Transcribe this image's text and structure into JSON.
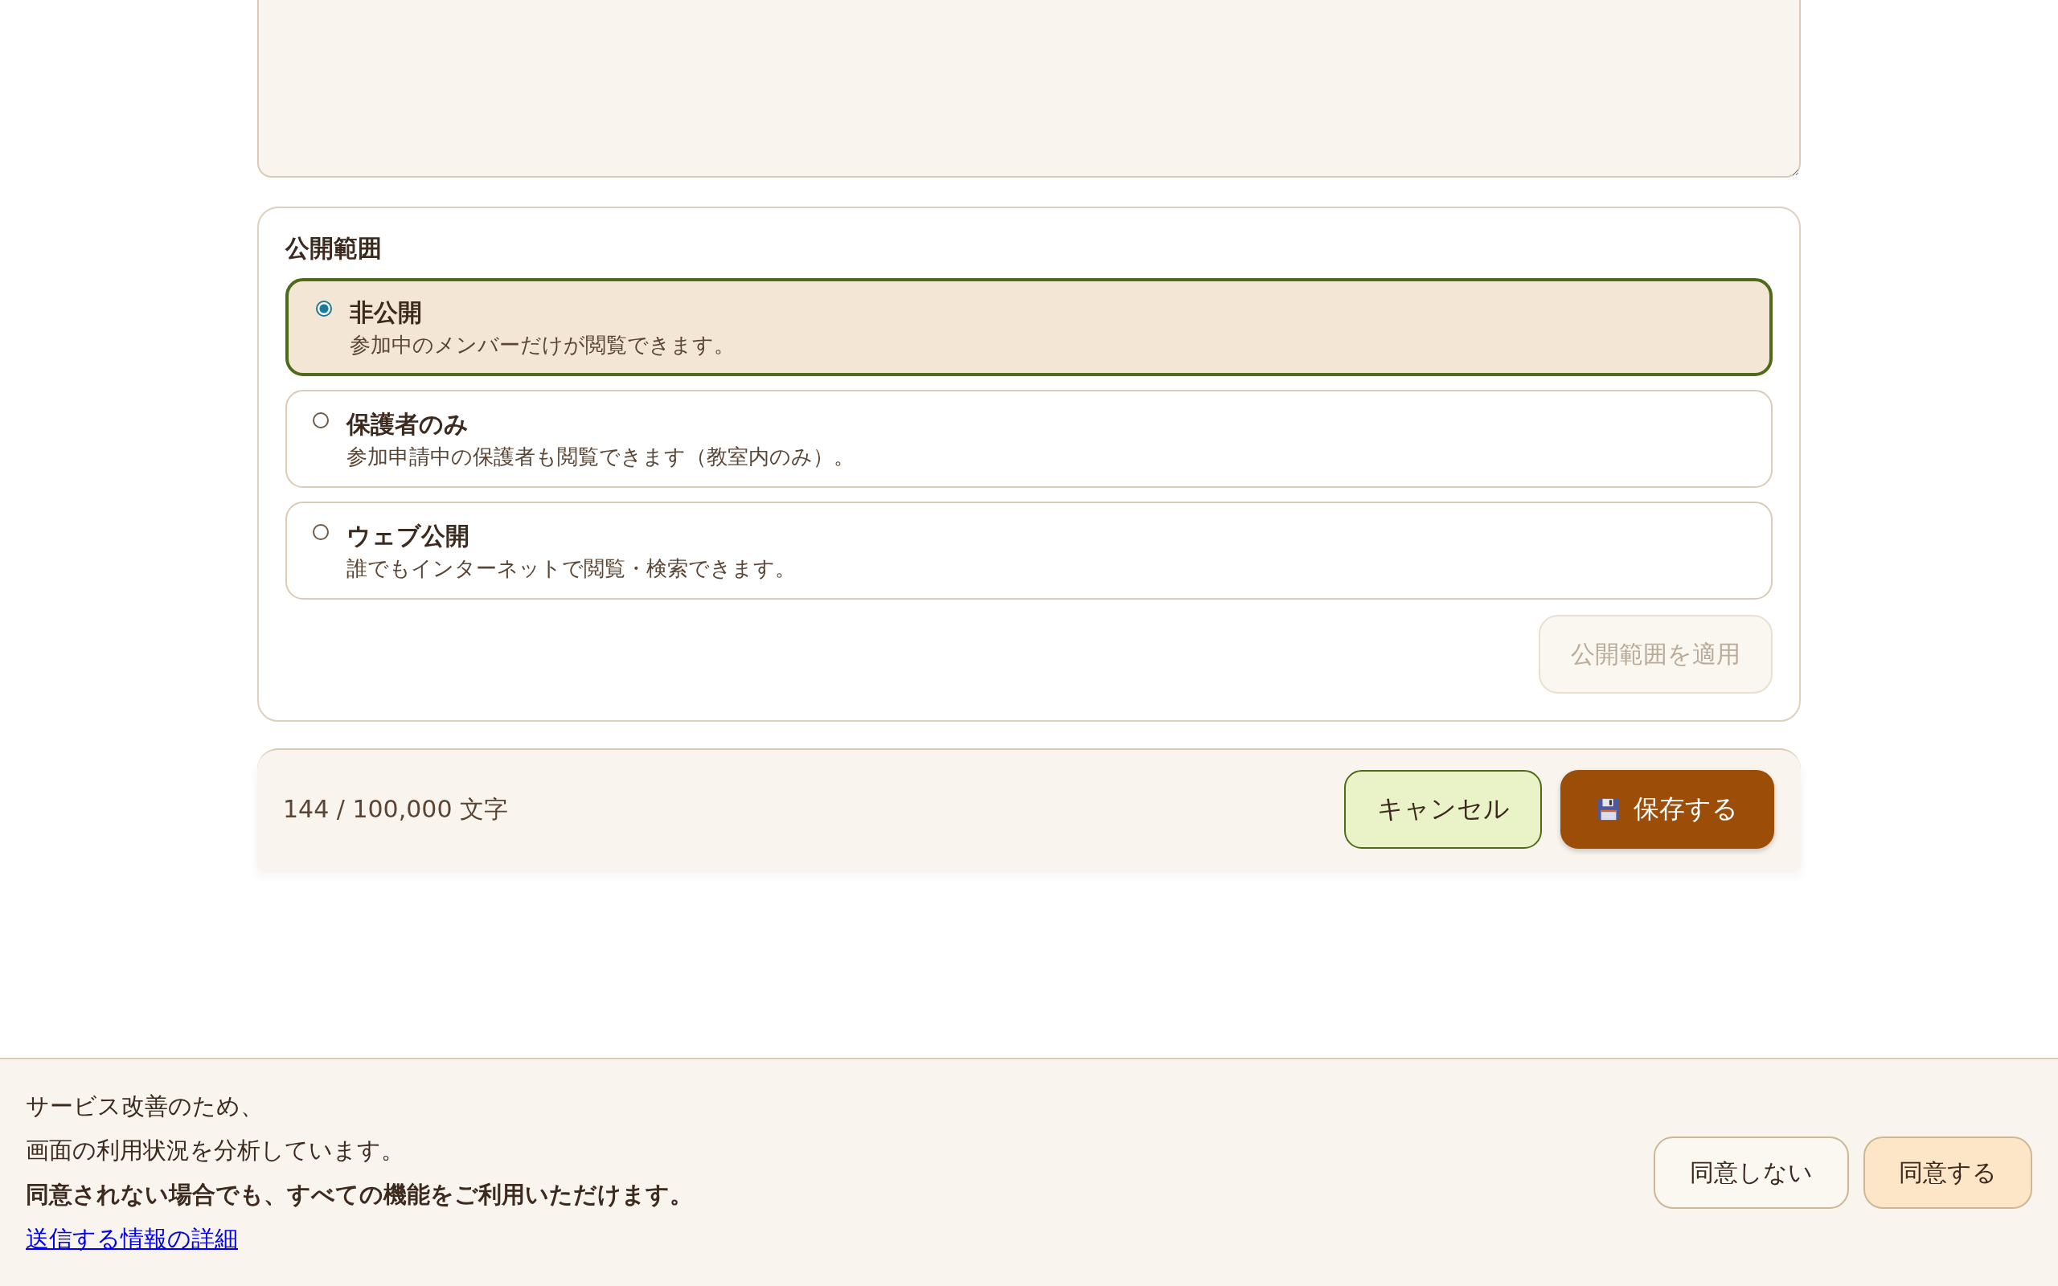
{
  "visibility": {
    "heading": "公開範囲",
    "options": [
      {
        "title": "非公開",
        "description": "参加中のメンバーだけが閲覧できます。",
        "selected": true
      },
      {
        "title": "保護者のみ",
        "description": "参加申請中の保護者も閲覧できます（教室内のみ）。",
        "selected": false
      },
      {
        "title": "ウェブ公開",
        "description": "誰でもインターネットで閲覧・検索できます。",
        "selected": false
      }
    ],
    "apply_button": {
      "label": "公開範囲を適用",
      "disabled": true
    }
  },
  "footer": {
    "char_count": "144 / 100,000 文字",
    "cancel_button": "キャンセル",
    "save_button": "保存する"
  },
  "consent_banner": {
    "message_lines": [
      "サービス改善のため、",
      "画面の利用状況を分析しています。"
    ],
    "note": "同意されない場合でも、すべての機能をご利用いただけます。",
    "link": "送信する情報の詳細",
    "buttons": [
      {
        "label": "同意しない",
        "kind": "decline"
      },
      {
        "label": "同意する",
        "kind": "accept"
      }
    ]
  }
}
